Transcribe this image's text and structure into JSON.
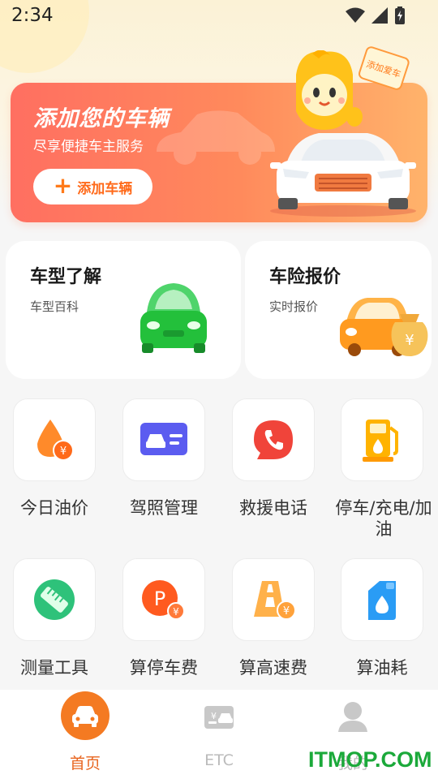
{
  "status_bar": {
    "time": "2:34"
  },
  "banner": {
    "title": "添加您的车辆",
    "subtitle": "尽享便捷车主服务",
    "add_button": "添加车辆",
    "mascot_sign": "添加爱车"
  },
  "cards": [
    {
      "title": "车型了解",
      "subtitle": "车型百科"
    },
    {
      "title": "车险报价",
      "subtitle": "实时报价"
    }
  ],
  "tools": [
    {
      "label": "今日油价",
      "icon": "oil-drop-yuan-icon"
    },
    {
      "label": "驾照管理",
      "icon": "license-card-icon"
    },
    {
      "label": "救援电话",
      "icon": "phone-call-icon"
    },
    {
      "label": "停车/充电/加油",
      "icon": "fuel-pump-icon"
    },
    {
      "label": "测量工具",
      "icon": "ruler-icon"
    },
    {
      "label": "算停车费",
      "icon": "parking-fee-icon"
    },
    {
      "label": "算高速费",
      "icon": "highway-fee-icon"
    },
    {
      "label": "算油耗",
      "icon": "fuel-tank-drop-icon"
    }
  ],
  "bottom_nav": [
    {
      "label": "首页",
      "icon": "car-icon",
      "active": true
    },
    {
      "label": "ETC",
      "icon": "etc-card-icon",
      "active": false
    },
    {
      "label": "我的",
      "icon": "user-icon",
      "active": false
    }
  ],
  "watermark": "ITMOP.COM",
  "colors": {
    "accent": "#e8641e",
    "banner_start": "#ff6f61",
    "banner_end": "#ffb36b",
    "watermark": "#1ba93a"
  }
}
